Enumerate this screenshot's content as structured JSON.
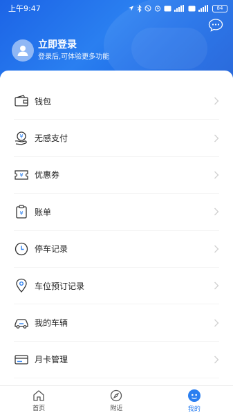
{
  "status_bar": {
    "time": "上午9:47",
    "battery": "84"
  },
  "header": {
    "chat_icon": "chat-bubble-icon",
    "login_title": "立即登录",
    "login_subtitle": "登录后,可体验更多功能",
    "colors": {
      "gradient_start": "#1c64e6",
      "gradient_end": "#1a5fd9"
    }
  },
  "menu": {
    "items": [
      {
        "label": "钱包",
        "icon": "wallet-icon"
      },
      {
        "label": "无感支付",
        "icon": "payment-hand-icon"
      },
      {
        "label": "优惠券",
        "icon": "coupon-icon"
      },
      {
        "label": "账单",
        "icon": "bill-icon"
      },
      {
        "label": "停车记录",
        "icon": "clock-icon"
      },
      {
        "label": "车位预订记录",
        "icon": "location-pin-icon"
      },
      {
        "label": "我的车辆",
        "icon": "car-icon"
      },
      {
        "label": "月卡管理",
        "icon": "card-icon"
      }
    ]
  },
  "tabbar": {
    "tabs": [
      {
        "label": "首页",
        "icon": "home-icon"
      },
      {
        "label": "附近",
        "icon": "compass-icon"
      },
      {
        "label": "我的",
        "icon": "profile-icon",
        "active": true
      }
    ],
    "accent": "#2b7ff0"
  }
}
